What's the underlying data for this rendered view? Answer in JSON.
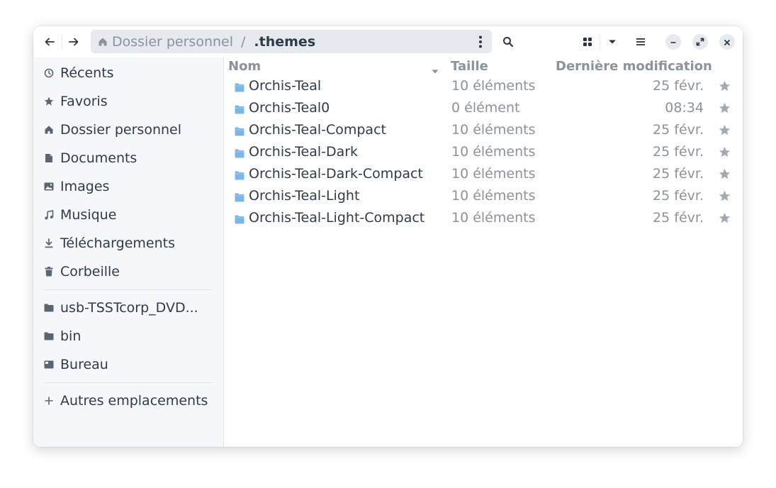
{
  "window": {
    "accent": "#2f3a4a",
    "folder_color": "#7ab6e8"
  },
  "header": {
    "back_icon": "arrow-left-icon",
    "forward_icon": "arrow-right-icon",
    "path": {
      "home_icon": "home-icon",
      "home_label": "Dossier personnel",
      "separator": "/",
      "current": ".themes",
      "menu_icon": "vertical-dots-icon"
    },
    "search_icon": "search-icon",
    "grid_icon": "grid-view-icon",
    "dropdown_icon": "chevron-down-icon",
    "menu_icon": "hamburger-menu-icon",
    "minimize_icon": "minimize-icon",
    "maximize_icon": "maximize-icon",
    "close_icon": "close-icon"
  },
  "sidebar": {
    "places": [
      {
        "label": "Récents",
        "icon": "clock-icon"
      },
      {
        "label": "Favoris",
        "icon": "star-icon"
      },
      {
        "label": "Dossier personnel",
        "icon": "home-icon"
      },
      {
        "label": "Documents",
        "icon": "document-icon"
      },
      {
        "label": "Images",
        "icon": "image-icon"
      },
      {
        "label": "Musique",
        "icon": "music-icon"
      },
      {
        "label": "Téléchargements",
        "icon": "download-icon"
      },
      {
        "label": "Corbeille",
        "icon": "trash-icon"
      }
    ],
    "bookmarks": [
      {
        "label": "usb-TSSTcorp_DVD...",
        "icon": "folder-icon"
      },
      {
        "label": "bin",
        "icon": "folder-icon"
      },
      {
        "label": "Bureau",
        "icon": "desktop-icon"
      }
    ],
    "other": {
      "label": "Autres emplacements",
      "icon": "plus-icon"
    }
  },
  "columns": {
    "name": "Nom",
    "size": "Taille",
    "modified": "Dernière modification"
  },
  "files": [
    {
      "name": "Orchis-Teal",
      "size": "10 éléments",
      "modified": "25 févr."
    },
    {
      "name": "Orchis-Teal0",
      "size": "0 élément",
      "modified": "08:34"
    },
    {
      "name": "Orchis-Teal-Compact",
      "size": "10 éléments",
      "modified": "25 févr."
    },
    {
      "name": "Orchis-Teal-Dark",
      "size": "10 éléments",
      "modified": "25 févr."
    },
    {
      "name": "Orchis-Teal-Dark-Compact",
      "size": "10 éléments",
      "modified": "25 févr."
    },
    {
      "name": "Orchis-Teal-Light",
      "size": "10 éléments",
      "modified": "25 févr."
    },
    {
      "name": "Orchis-Teal-Light-Compact",
      "size": "10 éléments",
      "modified": "25 févr."
    }
  ]
}
